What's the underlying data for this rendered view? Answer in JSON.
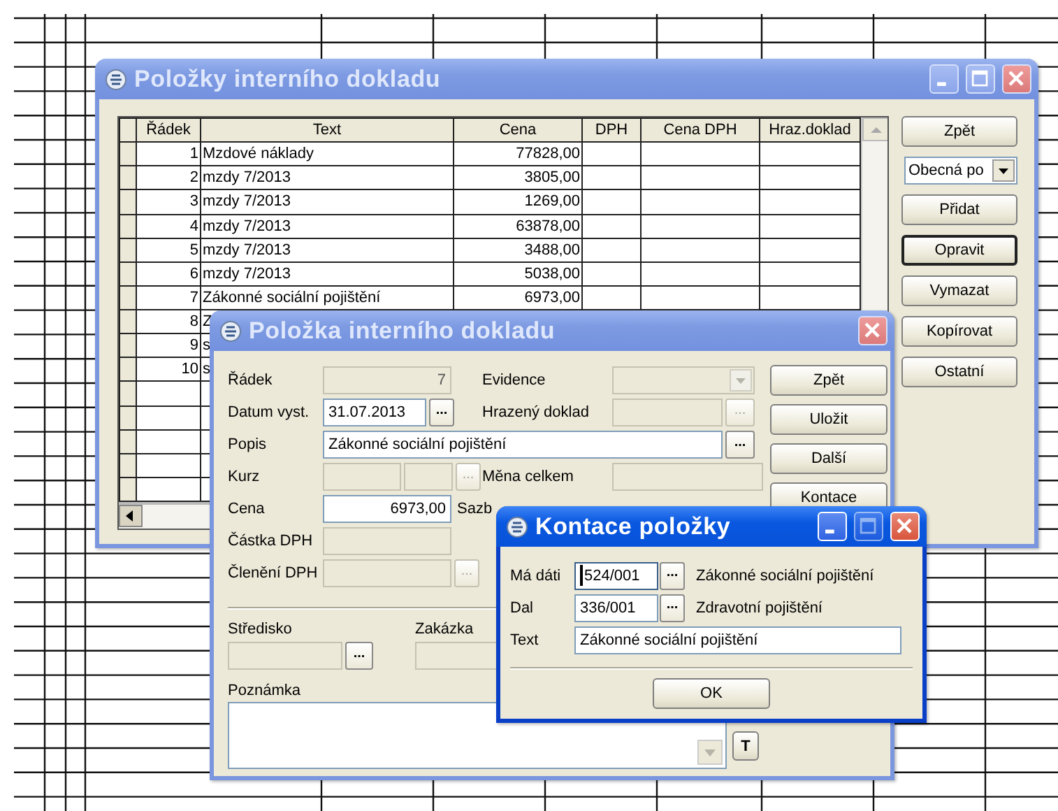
{
  "main_window": {
    "title": "Položky interního dokladu",
    "active": false,
    "controls": [
      {
        "kind": "minimize"
      },
      {
        "kind": "maximize"
      },
      {
        "kind": "close"
      }
    ],
    "columns": [
      "Řádek",
      "Text",
      "Cena",
      "DPH",
      "Cena DPH",
      "Hraz.doklad"
    ],
    "rows": [
      {
        "num": "1",
        "text": "Mzdové náklady",
        "price": "77828,00"
      },
      {
        "num": "2",
        "text": "mzdy 7/2013",
        "price": "3805,00"
      },
      {
        "num": "3",
        "text": "mzdy 7/2013",
        "price": "1269,00"
      },
      {
        "num": "4",
        "text": "mzdy 7/2013",
        "price": "63878,00"
      },
      {
        "num": "5",
        "text": "mzdy 7/2013",
        "price": "3488,00"
      },
      {
        "num": "6",
        "text": "mzdy 7/2013",
        "price": "5038,00"
      },
      {
        "num": "7",
        "text": "Zákonné sociální pojištění",
        "price": "6973,00"
      },
      {
        "num": "8",
        "text": "Z"
      },
      {
        "num": "9",
        "text": "s"
      },
      {
        "num": "10",
        "text": "s"
      }
    ],
    "buttons": [
      {
        "kind": "button",
        "label": "Zpět",
        "default": false
      },
      {
        "kind": "combo",
        "value": "Obecná po"
      },
      {
        "kind": "button",
        "label": "Přidat",
        "default": false
      },
      {
        "kind": "button",
        "label": "Opravit",
        "default": true
      },
      {
        "kind": "button",
        "label": "Vymazat",
        "default": false
      },
      {
        "kind": "button",
        "label": "Kopírovat",
        "default": false
      },
      {
        "kind": "button",
        "label": "Ostatní",
        "default": false
      }
    ]
  },
  "item_window": {
    "title": "Položka interního dokladu",
    "active": false,
    "controls": [
      {
        "kind": "close"
      }
    ],
    "rows": [
      {
        "label": "Řádek",
        "controls": [
          {
            "kind": "field",
            "value": "7",
            "enabled": false,
            "right_aligned": true
          }
        ],
        "label2": "Evidence",
        "controls2": [
          {
            "kind": "combo",
            "enabled": false
          }
        ]
      },
      {
        "label": "Datum vyst.",
        "controls": [
          {
            "kind": "field",
            "value": "31.07.2013",
            "enabled": true,
            "right_aligned": false
          },
          {
            "kind": "browse",
            "label": "...",
            "enabled": true
          }
        ],
        "label2": "Hrazený doklad",
        "controls2": [
          {
            "kind": "field",
            "enabled": false
          },
          {
            "kind": "browse",
            "label": "...",
            "enabled": false
          }
        ]
      },
      {
        "label": "Popis",
        "controls": [
          {
            "kind": "field",
            "value": "Zákonné sociální pojištění",
            "enabled": true,
            "right_aligned": false
          },
          {
            "kind": "browse",
            "label": "...",
            "enabled": true
          }
        ]
      },
      {
        "label": "Kurz",
        "controls": [
          {
            "kind": "field",
            "enabled": false
          },
          {
            "kind": "field",
            "enabled": false
          },
          {
            "kind": "browse",
            "label": "...",
            "enabled": false
          }
        ],
        "label2": "Měna celkem",
        "controls2": [
          {
            "kind": "field",
            "enabled": false
          }
        ]
      },
      {
        "label": "Cena",
        "controls": [
          {
            "kind": "field",
            "value": "6973,00",
            "enabled": true,
            "right_aligned": true
          }
        ],
        "label2": "Sazb"
      },
      {
        "label": "Částka DPH",
        "controls": [
          {
            "kind": "field",
            "enabled": false
          }
        ]
      },
      {
        "label": "Členění DPH",
        "controls": [
          {
            "kind": "field",
            "enabled": false
          },
          {
            "kind": "browse",
            "label": "...",
            "enabled": false
          }
        ]
      }
    ],
    "buttons": [
      {
        "label": "Zpět"
      },
      {
        "label": "Uložit"
      },
      {
        "label": "Další"
      },
      {
        "label": "Kontace"
      }
    ],
    "cost_center": {
      "label": "Středisko",
      "controls": [
        {
          "kind": "field",
          "enabled": false
        },
        {
          "kind": "browse",
          "label": "...",
          "enabled": true
        }
      ]
    },
    "order": {
      "label": "Zakázka",
      "controls": [
        {
          "kind": "field",
          "enabled": false
        }
      ]
    },
    "note": {
      "label": "Poznámka",
      "button": "T"
    }
  },
  "posting_window": {
    "title": "Kontace položky",
    "active": true,
    "controls": [
      {
        "kind": "minimize"
      },
      {
        "kind": "maximize"
      },
      {
        "kind": "close"
      }
    ],
    "rows": [
      {
        "label": "Má dáti",
        "value": "524/001",
        "focused": true,
        "browse": "...",
        "description": "Zákonné sociální pojištění"
      },
      {
        "label": "Dal",
        "value": "336/001",
        "focused": false,
        "browse": "...",
        "description": "Zdravotní pojištění"
      },
      {
        "label": "Text",
        "value": "Zákonné sociální pojištění",
        "focused": false
      }
    ],
    "ok": {
      "label": "OK"
    }
  }
}
